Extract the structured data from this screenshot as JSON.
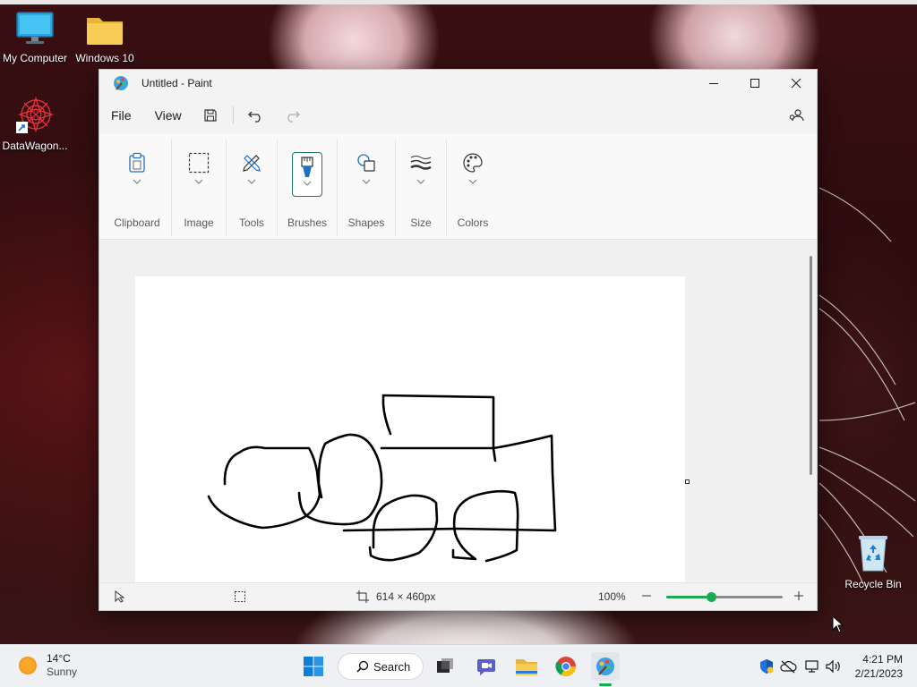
{
  "desktop": {
    "icons": [
      {
        "label": "My Computer"
      },
      {
        "label": "Windows 10"
      },
      {
        "label": "DataWagon..."
      },
      {
        "label": "Recycle Bin"
      }
    ]
  },
  "window": {
    "title": "Untitled - Paint",
    "menu": {
      "file": "File",
      "view": "View"
    },
    "ribbon": {
      "groups": [
        {
          "label": "Clipboard",
          "icon": "clipboard-icon"
        },
        {
          "label": "Image",
          "icon": "selection-icon"
        },
        {
          "label": "Tools",
          "icon": "pencil-icon"
        },
        {
          "label": "Brushes",
          "icon": "brush-icon",
          "selected": true
        },
        {
          "label": "Shapes",
          "icon": "shapes-icon"
        },
        {
          "label": "Size",
          "icon": "size-icon"
        },
        {
          "label": "Colors",
          "icon": "palette-icon"
        }
      ]
    },
    "status": {
      "canvas_size": "614 × 460px",
      "zoom": "100%",
      "zoom_level": 0.39
    }
  },
  "taskbar": {
    "weather": {
      "temp": "14°C",
      "condition": "Sunny"
    },
    "search_label": "Search",
    "clock": {
      "time": "4:21 PM",
      "date": "2/21/2023"
    }
  },
  "colors": {
    "accent_green": "#1aaa55",
    "selected_border": "#1f7a5a"
  }
}
